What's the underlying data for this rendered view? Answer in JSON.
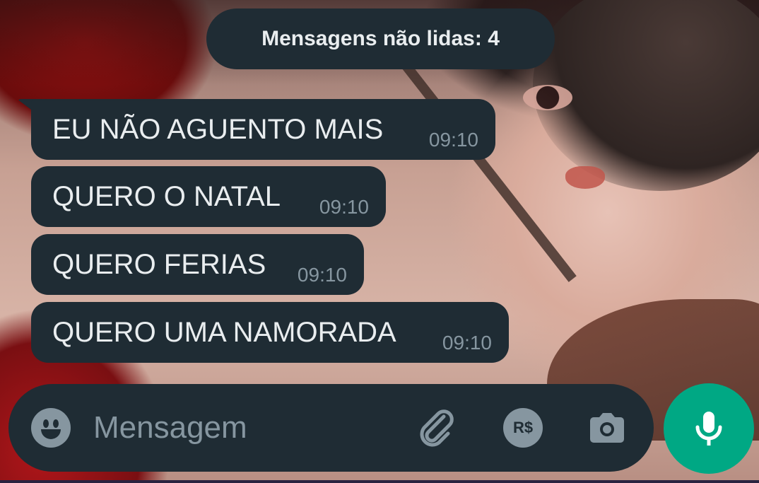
{
  "unread_banner": {
    "text": "Mensagens não lidas: 4"
  },
  "messages": [
    {
      "text": "EU NÃO AGUENTO MAIS",
      "time": "09:10"
    },
    {
      "text": "QUERO O NATAL",
      "time": "09:10"
    },
    {
      "text": "QUERO FERIAS",
      "time": "09:10"
    },
    {
      "text": "QUERO UMA NAMORADA",
      "time": "09:10"
    }
  ],
  "composer": {
    "placeholder": "Mensagem",
    "value": "",
    "emoji_icon": "emoji-icon",
    "attach_icon": "paperclip-icon",
    "payment_icon": "payment-icon",
    "payment_label": "R$",
    "camera_icon": "camera-icon"
  },
  "mic_icon": "microphone-icon",
  "colors": {
    "bubble": "#1f2c34",
    "text": "#e9edef",
    "meta": "#8696a0",
    "accent": "#00a884"
  }
}
